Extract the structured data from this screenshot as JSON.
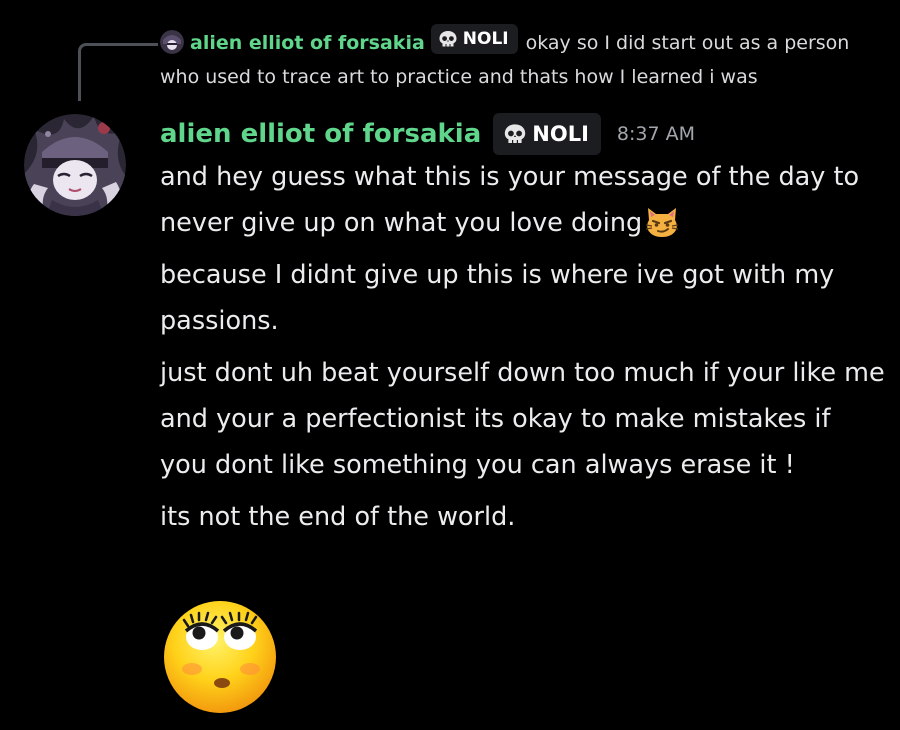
{
  "reply": {
    "author": "alien elliot of forsakia",
    "tag": "NOLI",
    "text": "okay so I did start out as a person who used to trace art to practice and thats how I learned i was"
  },
  "message": {
    "author": "alien elliot of forsakia",
    "tag": "NOLI",
    "timestamp": "8:37 AM",
    "paragraphs": [
      "and hey guess what this is your message of the day to never give up on what you love doing",
      "because I didnt give up this is where ive got with my passions.",
      "just dont uh beat yourself down too much if your like me and your a perfectionist its okay to make mistakes if you dont like something you can always erase it !",
      "its not the end of the world."
    ],
    "inline_emoji": "smirk-cat-emoji",
    "big_emoji": "flushed-eyelashes-emoji"
  },
  "colors": {
    "background": "#000000",
    "username": "#5fd68c",
    "tag_background": "#1c1d20",
    "timestamp": "#a3a6ad",
    "text": "#ececee",
    "reply_spine": "#4e5058"
  }
}
